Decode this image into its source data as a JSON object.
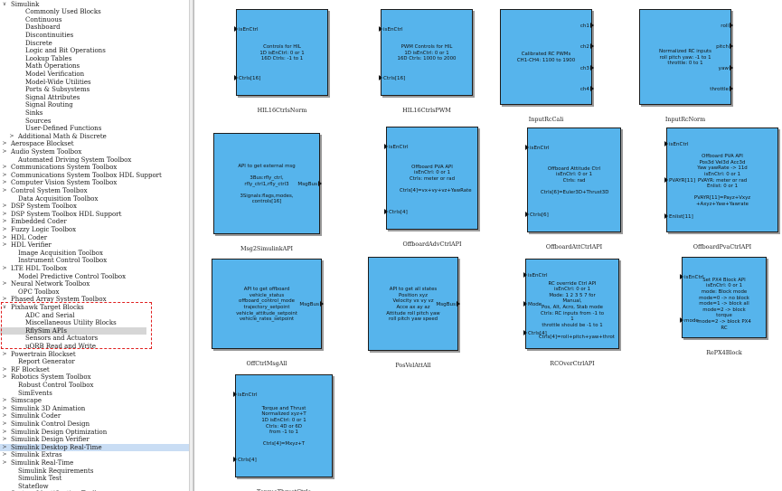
{
  "library_tree": [
    {
      "label": "Simulink",
      "depth": 0,
      "expanded": true
    },
    {
      "label": "Commonly Used Blocks",
      "depth": 2
    },
    {
      "label": "Continuous",
      "depth": 2
    },
    {
      "label": "Dashboard",
      "depth": 2
    },
    {
      "label": "Discontinuities",
      "depth": 2
    },
    {
      "label": "Discrete",
      "depth": 2
    },
    {
      "label": "Logic and Bit Operations",
      "depth": 2
    },
    {
      "label": "Lookup Tables",
      "depth": 2
    },
    {
      "label": "Math Operations",
      "depth": 2
    },
    {
      "label": "Model Verification",
      "depth": 2
    },
    {
      "label": "Model-Wide Utilities",
      "depth": 2
    },
    {
      "label": "Ports & Subsystems",
      "depth": 2
    },
    {
      "label": "Signal Attributes",
      "depth": 2
    },
    {
      "label": "Signal Routing",
      "depth": 2
    },
    {
      "label": "Sinks",
      "depth": 2
    },
    {
      "label": "Sources",
      "depth": 2
    },
    {
      "label": "User-Defined Functions",
      "depth": 2
    },
    {
      "label": "Additional Math & Discrete",
      "depth": 1,
      "expanded": false
    },
    {
      "label": "Aerospace Blockset",
      "depth": 0,
      "expanded": false
    },
    {
      "label": "Audio System Toolbox",
      "depth": 0,
      "expanded": false
    },
    {
      "label": "Automated Driving System Toolbox",
      "depth": 1
    },
    {
      "label": "Communications System Toolbox",
      "depth": 0,
      "expanded": false
    },
    {
      "label": "Communications System Toolbox HDL Support",
      "depth": 0,
      "expanded": false
    },
    {
      "label": "Computer Vision System Toolbox",
      "depth": 0,
      "expanded": false
    },
    {
      "label": "Control System Toolbox",
      "depth": 0,
      "expanded": false
    },
    {
      "label": "Data Acquisition Toolbox",
      "depth": 1
    },
    {
      "label": "DSP System Toolbox",
      "depth": 0,
      "expanded": false
    },
    {
      "label": "DSP System Toolbox HDL Support",
      "depth": 0,
      "expanded": false
    },
    {
      "label": "Embedded Coder",
      "depth": 0,
      "expanded": false
    },
    {
      "label": "Fuzzy Logic Toolbox",
      "depth": 0,
      "expanded": false
    },
    {
      "label": "HDL Coder",
      "depth": 0,
      "expanded": false
    },
    {
      "label": "HDL Verifier",
      "depth": 0,
      "expanded": false
    },
    {
      "label": "Image Acquisition Toolbox",
      "depth": 1
    },
    {
      "label": "Instrument Control Toolbox",
      "depth": 1
    },
    {
      "label": "LTE HDL Toolbox",
      "depth": 0,
      "expanded": false
    },
    {
      "label": "Model Predictive Control Toolbox",
      "depth": 1
    },
    {
      "label": "Neural Network Toolbox",
      "depth": 0,
      "expanded": false
    },
    {
      "label": "OPC Toolbox",
      "depth": 1
    },
    {
      "label": "Phased Array System Toolbox",
      "depth": 0,
      "expanded": false
    },
    {
      "label": "Pixhawk Target Blocks",
      "depth": 0,
      "expanded": true
    },
    {
      "label": "ADC and Serial",
      "depth": 2
    },
    {
      "label": "Miscellaneous Utility Blocks",
      "depth": 2
    },
    {
      "label": "RflySim APIs",
      "depth": 2,
      "selected_gray": true
    },
    {
      "label": "Sensors and Actuators",
      "depth": 2
    },
    {
      "label": "uORB Read and Write",
      "depth": 2
    },
    {
      "label": "Powertrain Blockset",
      "depth": 0,
      "expanded": false
    },
    {
      "label": "Report Generator",
      "depth": 1
    },
    {
      "label": "RF Blockset",
      "depth": 0,
      "expanded": false
    },
    {
      "label": "Robotics System Toolbox",
      "depth": 0,
      "expanded": false
    },
    {
      "label": "Robust Control Toolbox",
      "depth": 1
    },
    {
      "label": "SimEvents",
      "depth": 1
    },
    {
      "label": "Simscape",
      "depth": 0,
      "expanded": false
    },
    {
      "label": "Simulink 3D Animation",
      "depth": 0,
      "expanded": false
    },
    {
      "label": "Simulink Coder",
      "depth": 0,
      "expanded": false
    },
    {
      "label": "Simulink Control Design",
      "depth": 0,
      "expanded": false
    },
    {
      "label": "Simulink Design Optimization",
      "depth": 0,
      "expanded": false
    },
    {
      "label": "Simulink Design Verifier",
      "depth": 0,
      "expanded": false
    },
    {
      "label": "Simulink Desktop Real-Time",
      "depth": 0,
      "expanded": false,
      "selected": true
    },
    {
      "label": "Simulink Extras",
      "depth": 0,
      "expanded": false
    },
    {
      "label": "Simulink Real-Time",
      "depth": 0,
      "expanded": false
    },
    {
      "label": "Simulink Requirements",
      "depth": 1
    },
    {
      "label": "Simulink Test",
      "depth": 1
    },
    {
      "label": "Stateflow",
      "depth": 1
    },
    {
      "label": "System Identification Toolbox",
      "depth": 0,
      "expanded": false
    }
  ],
  "blocks": [
    {
      "name": "HIL16CtrlsNorm",
      "inputs": [
        "isEnCtrl",
        "Ctrls[16]"
      ],
      "outputs": [],
      "body": "Controls for HIL\n1D isEnCtrl: 0 or 1\n16D Ctrls: -1 to 1"
    },
    {
      "name": "HIL16CtrlsPWM",
      "inputs": [
        "isEnCtrl",
        "Ctrls[16]"
      ],
      "outputs": [],
      "body": "PWM Controls for HIL\n1D isEnCtrl: 0 or 1\n16D Ctrls: 1000 to 2000"
    },
    {
      "name": "InputRcCali",
      "inputs": [],
      "outputs": [
        "ch1",
        "ch2",
        "ch3",
        "ch4"
      ],
      "body": "Calibrated RC PWMs\nCH1-CH4: 1100 to 1900"
    },
    {
      "name": "InputRcNorm",
      "inputs": [],
      "outputs": [
        "roll",
        "pitch",
        "yaw",
        "throttle"
      ],
      "body": "Normalized RC inputs\nroll pitch yaw: -1 to 1\nthrottle: 0 to 1"
    },
    {
      "name": "Msg2SimulinkAPI",
      "inputs": [],
      "outputs": [
        "MsgBus"
      ],
      "body": "API to get external msg\n\n3Bus:rfly_ctrl,\nrfly_ctrl1,rfly_ctrl3\n\n3Signals:flags,modes,\ncontrols[16]"
    },
    {
      "name": "OffboardAdvCtrlAPI",
      "inputs": [
        "isEnCtrl",
        "Ctrls[4]"
      ],
      "outputs": [],
      "body": "Offboard PVA API\nisEnCtrl: 0 or 1\nCtrls: meter or rad\n\nCtrls[4]=vx+vy+vz+YawRate"
    },
    {
      "name": "OffboardAttCtrlAPI",
      "inputs": [
        "isEnCtrl",
        "Ctrls[6]"
      ],
      "outputs": [],
      "body": "Offboard Attitude Ctrl\nisEnCtrl: 0 or 1\nCtrls: rad\n\nCtrls[6]=Euler3D+Thrust3D"
    },
    {
      "name": "OffboardPvaCtrlAPI",
      "inputs": [
        "isEnCtrl",
        "PVAYR[11]",
        "Enlist[11]"
      ],
      "outputs": [],
      "body": "Offboard PVA API\nPos3d Vel3d Acc3d\nYaw yawRate -> 11d\nisEnCtrl: 0 or 1\nPVAYR: meter or rad\nEnlist: 0 or 1\n\nPVAYR[11]=Payz+Vxyz\n+Axyz+Yaw+Yawrate"
    },
    {
      "name": "OffCtrlMsgAll",
      "inputs": [],
      "outputs": [
        "MsgBus"
      ],
      "body": "API to get offboard\nvehicle_status\noffboard_control_mode\ntrajectory_setpoint\nvehicle_attitude_setpoint\nvehicle_rates_setpoint"
    },
    {
      "name": "PosVelAttAll",
      "inputs": [],
      "outputs": [
        "MsgBus"
      ],
      "body": "API to get all states\nPosition xyz\nVelocity vx vy vz\nAcce ax ay az\nAttitude roll pitch yaw\nroll pitch yaw speed"
    },
    {
      "name": "RCOverCtrlAPI",
      "inputs": [
        "isEnCtrl",
        "Mode",
        "Ctrls[4]"
      ],
      "outputs": [],
      "body": "RC override Ctrl API\nisEnCtrl: 0 or 1\nMode: 1 2 3 5 7 for Manual,\nPos, Alt, Acro, Stab mode\nCtrls: RC inputs from -1 to 1\nthrottle should be -1 to 1\n\nCtrls[4]=roll+pitch+yaw+throt"
    },
    {
      "name": "RePX4Block",
      "inputs": [
        "isEnCtrl",
        "mode"
      ],
      "outputs": [],
      "body": "Set PX4 Block API\nisEnCtrl: 0 or 1\nmode: Block mode\nmode=0 -> no block\nmode=1 -> block all\nmode=2 -> block torque\nmode=2 -> block PX4 RC"
    },
    {
      "name": "TorqueThrustCtrls",
      "inputs": [
        "isEnCtrl",
        "Ctrls[4]"
      ],
      "outputs": [],
      "body": "Torque and Thrust\nNormalized xyz+T\n1D isEnCtrl: 0 or 1\nCtrls: 4D or 6D\nfrom -1 to 1\n\nCtrls[4]=Mxyz+T"
    }
  ]
}
